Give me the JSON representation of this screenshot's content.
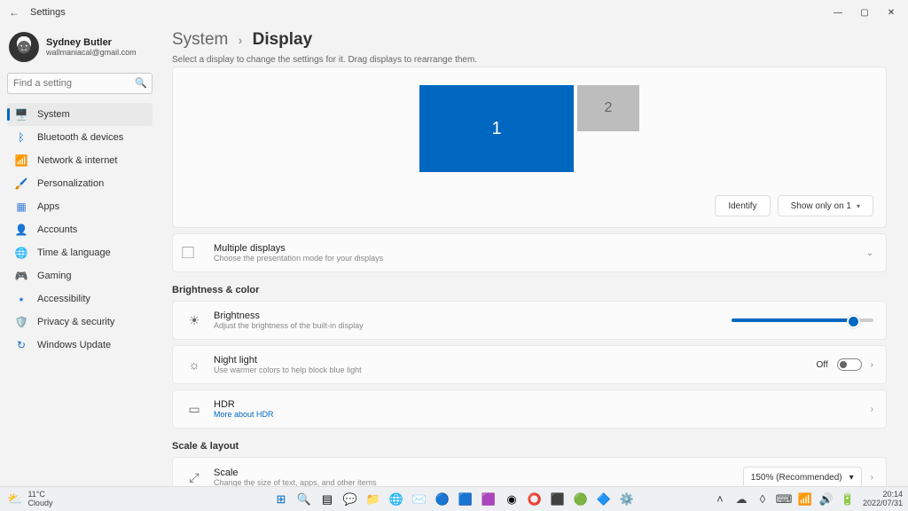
{
  "window": {
    "title": "Settings"
  },
  "user": {
    "name": "Sydney Butler",
    "email": "wallmaniacal@gmail.com"
  },
  "search": {
    "placeholder": "Find a setting"
  },
  "nav": {
    "items": [
      {
        "icon": "🖥️",
        "label": "System",
        "color": "#0067c0"
      },
      {
        "icon": "ᛒ",
        "label": "Bluetooth & devices",
        "color": "#0067c0"
      },
      {
        "icon": "📶",
        "label": "Network & internet",
        "color": "#0aa0d8"
      },
      {
        "icon": "🖌️",
        "label": "Personalization",
        "color": "#c47b3b"
      },
      {
        "icon": "▦",
        "label": "Apps",
        "color": "#3b7dd8"
      },
      {
        "icon": "👤",
        "label": "Accounts",
        "color": "#d8893b"
      },
      {
        "icon": "🌐",
        "label": "Time & language",
        "color": "#1a9fc4"
      },
      {
        "icon": "🎮",
        "label": "Gaming",
        "color": "#888"
      },
      {
        "icon": "⭑",
        "label": "Accessibility",
        "color": "#1a6fc4"
      },
      {
        "icon": "🛡️",
        "label": "Privacy & security",
        "color": "#888"
      },
      {
        "icon": "↻",
        "label": "Windows Update",
        "color": "#1a6fc4"
      }
    ],
    "selectedIndex": 0
  },
  "breadcrumb": {
    "parent": "System",
    "current": "Display"
  },
  "subtitle": "Select a display to change the settings for it. Drag displays to rearrange them.",
  "displays": {
    "mon1": "1",
    "mon2": "2",
    "identify": "Identify",
    "showOnly": "Show only on 1"
  },
  "multipleDisplays": {
    "title": "Multiple displays",
    "desc": "Choose the presentation mode for your displays"
  },
  "sectionBrightness": "Brightness & color",
  "brightness": {
    "title": "Brightness",
    "desc": "Adjust the brightness of the built-in display"
  },
  "nightLight": {
    "title": "Night light",
    "desc": "Use warmer colors to help block blue light",
    "state": "Off"
  },
  "hdr": {
    "title": "HDR",
    "link": "More about HDR"
  },
  "sectionScale": "Scale & layout",
  "scale": {
    "title": "Scale",
    "desc": "Change the size of text, apps, and other items",
    "value": "150% (Recommended)"
  },
  "weather": {
    "temp": "11°C",
    "cond": "Cloudy"
  },
  "clock": {
    "time": "20:14",
    "date": "2022/07/31"
  }
}
